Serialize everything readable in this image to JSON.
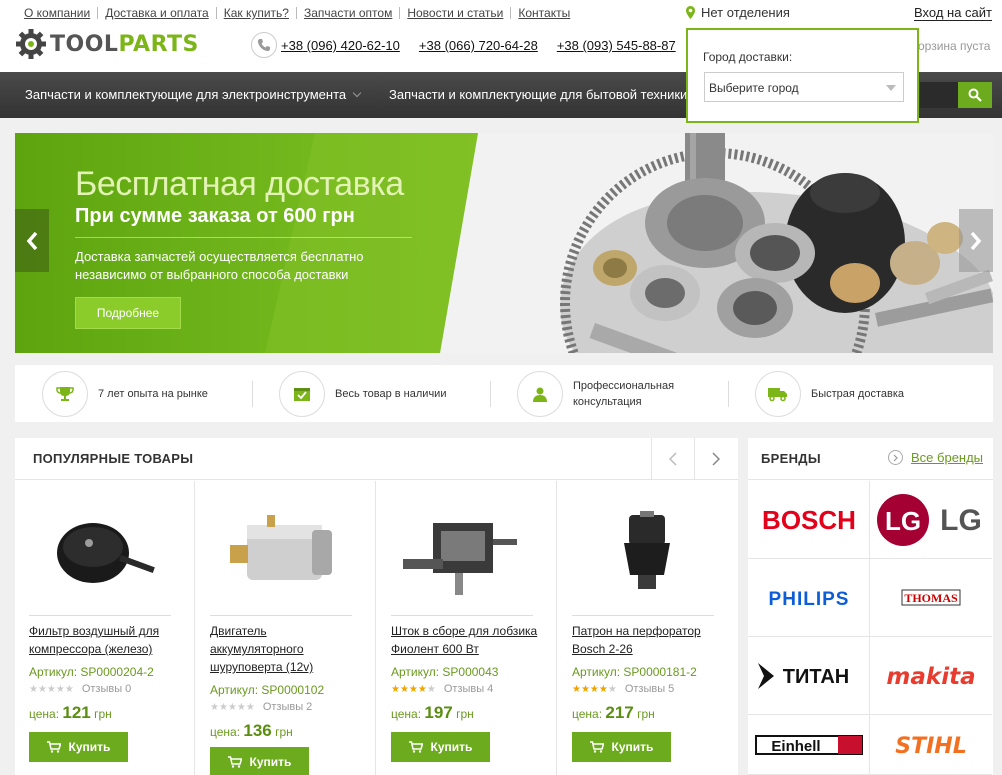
{
  "top_links": [
    "О компании",
    "Доставка и оплата",
    "Как купить?",
    "Запчасти оптом",
    "Новости и статьи",
    "Контакты"
  ],
  "branch": "Нет отделения",
  "login": "Вход на сайт",
  "logo": {
    "tool": "TOOL",
    "parts": "PARTS"
  },
  "phones": [
    "+38 (096) 420-62-10",
    "+38 (066) 720-64-28",
    "+38 (093) 545-88-87"
  ],
  "cart": "орзина пуста",
  "city": {
    "label": "Город доставки:",
    "placeholder": "Выберите город"
  },
  "nav": {
    "item1": "Запчасти и комплектующие для электроинструмента",
    "item2": "Запчасти и комплектующие для бытовой техники"
  },
  "banner": {
    "title": "Бесплатная доставка",
    "subtitle": "При сумме заказа от 600 грн",
    "text": "Доставка запчастей осуществляется бесплатно независимо от выбранного способа доставки",
    "button": "Подробнее"
  },
  "features": [
    "7 лет опыта на рынке",
    "Весь товар в наличии",
    "Профессиональная консультация",
    "Быстрая доставка"
  ],
  "popular": {
    "title": "ПОПУЛЯРНЫЕ ТОВАРЫ",
    "price_label": "цена:",
    "currency": "грн",
    "buy": "Купить",
    "reviews_label": "Отзывы",
    "products": [
      {
        "name": "Фильтр воздушный для компрессора (железо)",
        "sku": "Артикул: SP0000204-2",
        "rating": 0,
        "reviews": "Отзывы 0",
        "price": "121"
      },
      {
        "name": "Двигатель аккумуляторного шуруповерта (12v)",
        "sku": "Артикул: SP0000102",
        "rating": 0,
        "reviews": "Отзывы 2",
        "price": "136"
      },
      {
        "name": "Шток в сборе для лобзика Фиолент 600 Вт",
        "sku": "Артикул: SP000043",
        "rating": 4,
        "reviews": "Отзывы 4",
        "price": "197"
      },
      {
        "name": "Патрон на перфоратор Bosch 2-26",
        "sku": "Артикул: SP0000181-2",
        "rating": 4,
        "reviews": "Отзывы 5",
        "price": "217"
      }
    ]
  },
  "brands": {
    "title": "БРЕНДЫ",
    "all": "Все бренды",
    "items": [
      "BOSCH",
      "LG",
      "PHILIPS",
      "THOMAS",
      "ТИТАН",
      "makita",
      "Einhell",
      "STIHL"
    ]
  },
  "colors": {
    "accent": "#7cb518",
    "button": "#6cab1d",
    "nav_bg": "#3a3a3a"
  }
}
